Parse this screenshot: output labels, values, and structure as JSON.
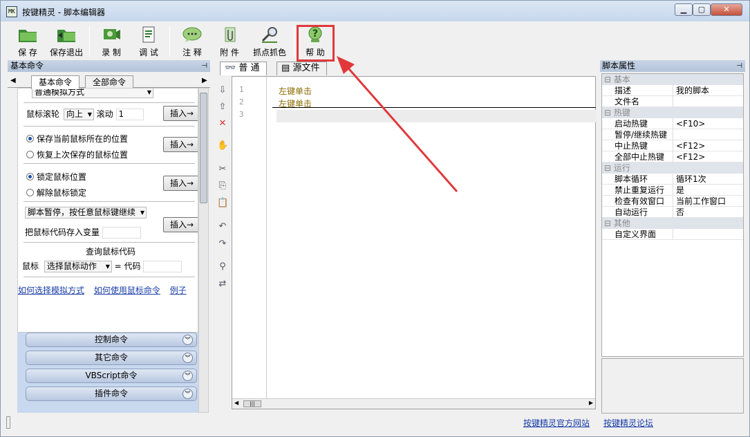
{
  "window": {
    "title": "按键精灵 - 脚本编辑器",
    "icon": "app-logo-icon",
    "minimize": "▁",
    "maximize": "▢",
    "close": "✕"
  },
  "toolbar": {
    "save": "保 存",
    "save_exit": "保存退出",
    "record": "录 制",
    "debug": "调 试",
    "comment": "注 释",
    "attach": "附 件",
    "pick": "抓点抓色",
    "help": "帮 助"
  },
  "left_panel": {
    "title": "基本命令",
    "tabs": [
      "基本命令",
      "全部命令"
    ],
    "mode_select": "普通模拟方式",
    "wheel_label": "鼠标滚轮",
    "wheel_dir": "向上",
    "scroll_label": "滚动",
    "scroll_value": "1",
    "insert": "插入→",
    "radio_save_pos": "保存当前鼠标所在的位置",
    "radio_restore_pos": "恢复上次保存的鼠标位置",
    "radio_lock": "锁定鼠标位置",
    "radio_unlock": "解除鼠标锁定",
    "pause_select": "脚本暂停，按任意鼠标键继续",
    "store_code": "把鼠标代码存入变量",
    "query_title": "查询鼠标代码",
    "mouse_label": "鼠标",
    "action_select": "选择鼠标动作",
    "eq_code": "= 代码",
    "link_choose": "如何选择模拟方式",
    "link_howto": "如何使用鼠标命令",
    "link_example": "例子",
    "groups": [
      "控制命令",
      "其它命令",
      "VBScript命令",
      "插件命令"
    ]
  },
  "editor": {
    "tab_normal": "普 通",
    "tab_source": "源文件",
    "lines": [
      "1",
      "2",
      "3"
    ],
    "code": [
      "左键单击",
      "左键单击"
    ]
  },
  "props": {
    "title": "脚本属性",
    "cat_basic": "基本",
    "cat_hotkey": "热键",
    "cat_run": "运行",
    "cat_other": "其他",
    "rows_basic": [
      [
        "描述",
        "我的脚本"
      ],
      [
        "文件名",
        ""
      ]
    ],
    "rows_hotkey": [
      [
        "启动热键",
        "<F10>"
      ],
      [
        "暂停/继续热键",
        ""
      ],
      [
        "中止热键",
        "<F12>"
      ],
      [
        "全部中止热键",
        "<F12>"
      ]
    ],
    "rows_run": [
      [
        "脚本循环",
        "循环1次"
      ],
      [
        "禁止重复运行",
        "是"
      ],
      [
        "检查有效窗口",
        "当前工作窗口"
      ],
      [
        "自动运行",
        "否"
      ]
    ],
    "rows_other": [
      [
        "自定义界面",
        ""
      ]
    ]
  },
  "status": {
    "link1": "按键精灵官方网站",
    "link2": "按键精灵论坛"
  },
  "colors": {
    "annotation": "#e0383b",
    "link": "#1a3da8"
  }
}
